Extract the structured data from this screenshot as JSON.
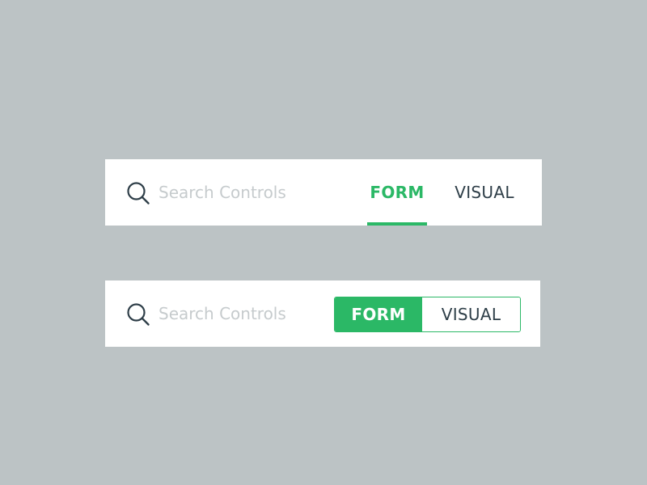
{
  "colors": {
    "background": "#bcc3c5",
    "accent": "#2bb866",
    "text": "#2e3e48",
    "placeholder": "#c6cbcd"
  },
  "tab_bar": {
    "search": {
      "icon": "search-icon",
      "value": "",
      "placeholder": "Search Controls"
    },
    "tabs": [
      {
        "label": "FORM",
        "selected": true
      },
      {
        "label": "VISUAL",
        "selected": false
      }
    ]
  },
  "segmented_bar": {
    "search": {
      "icon": "search-icon",
      "value": "",
      "placeholder": "Search Controls"
    },
    "options": [
      {
        "label": "FORM",
        "selected": true
      },
      {
        "label": "VISUAL",
        "selected": false
      }
    ]
  }
}
